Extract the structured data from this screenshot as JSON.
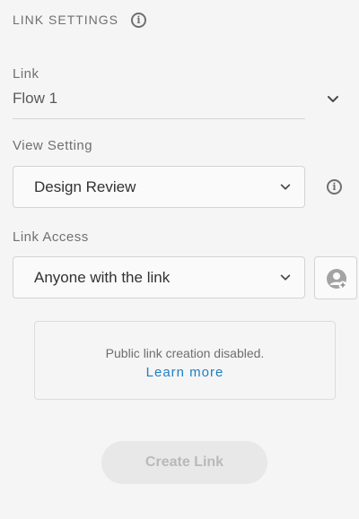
{
  "header": {
    "title": "LINK SETTINGS"
  },
  "link": {
    "label": "Link",
    "value": "Flow 1"
  },
  "view_setting": {
    "label": "View Setting",
    "selected": "Design Review"
  },
  "link_access": {
    "label": "Link Access",
    "selected": "Anyone with the link"
  },
  "notice": {
    "message": "Public link creation disabled.",
    "link_text": "Learn more"
  },
  "actions": {
    "create_label": "Create Link",
    "create_enabled": false
  },
  "colors": {
    "background": "#f5f5f5",
    "accent_link": "#1d7fc4",
    "disabled_button_bg": "#e8e8e8",
    "disabled_button_text": "#b9b9b9"
  },
  "icons": {
    "header_info": "info-icon",
    "dropdown": "chevron-down-icon",
    "invite": "add-user-icon"
  }
}
